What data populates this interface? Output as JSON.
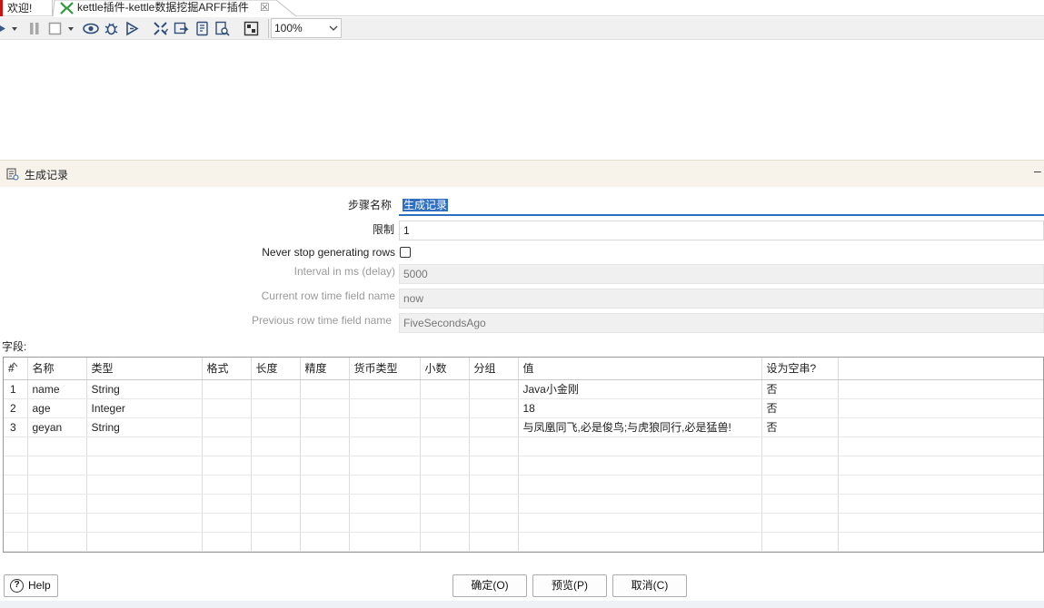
{
  "tabs": [
    {
      "label": "欢迎!"
    },
    {
      "label": "kettle插件-kettle数据挖掘ARFF插件",
      "close": "☒"
    }
  ],
  "toolbar": {
    "zoom": "100%"
  },
  "dialog": {
    "title": "生成记录",
    "minimize": "–"
  },
  "form": {
    "step_name_label": "步骤名称",
    "step_name_value": "生成记录",
    "limit_label": "限制",
    "limit_value": "1",
    "never_stop_label": "Never stop generating rows",
    "never_stop_checked": false,
    "interval_label": "Interval in ms (delay)",
    "interval_value": "5000",
    "current_row_label": "Current row time field name",
    "current_row_value": "now",
    "previous_row_label": "Previous row time field name",
    "previous_row_value": "FiveSecondsAgo"
  },
  "fields": {
    "label": "字段:",
    "columns": [
      "#",
      "名称",
      "类型",
      "格式",
      "长度",
      "精度",
      "货币类型",
      "小数",
      "分组",
      "值",
      "设为空串?"
    ],
    "rows": [
      [
        "1",
        "name",
        "String",
        "",
        "",
        "",
        "",
        "",
        "",
        "Java小金刚",
        "否"
      ],
      [
        "2",
        "age",
        "Integer",
        "",
        "",
        "",
        "",
        "",
        "",
        "18",
        "否"
      ],
      [
        "3",
        "geyan",
        "String",
        "",
        "",
        "",
        "",
        "",
        "",
        "与凤凰同飞,必是俊鸟;与虎狼同行,必是猛兽!",
        "否"
      ]
    ]
  },
  "buttons": {
    "help": "Help",
    "ok": "确定(O)",
    "preview": "预览(P)",
    "cancel": "取消(C)"
  }
}
